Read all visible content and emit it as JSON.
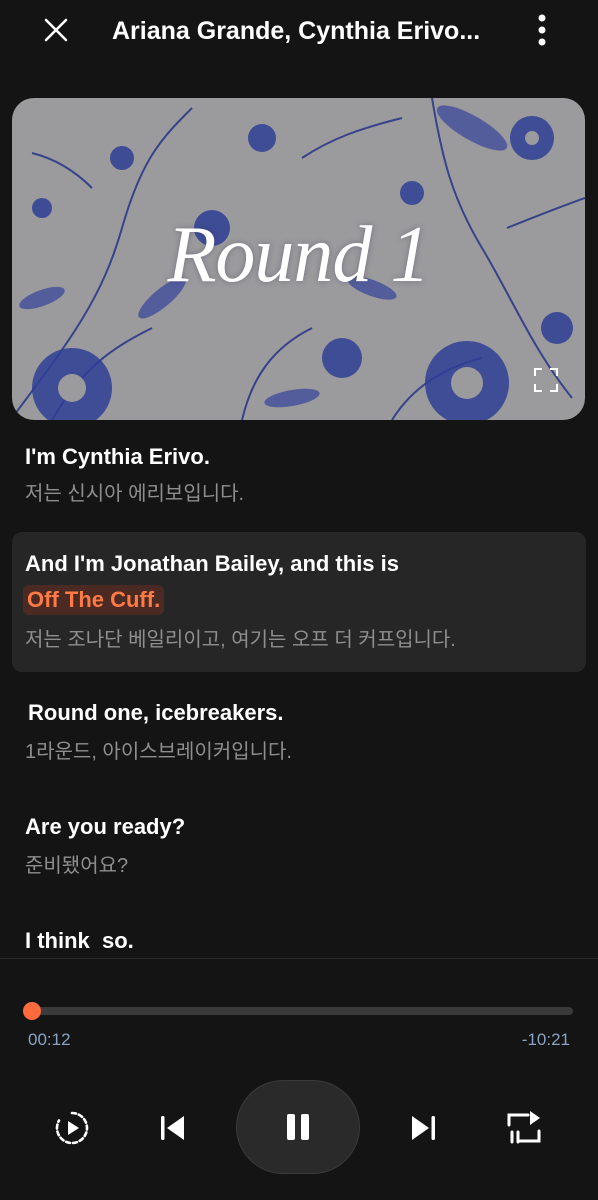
{
  "header": {
    "title": "Ariana Grande, Cynthia Erivo...",
    "close_icon": "close-icon",
    "more_icon": "more-vertical-icon"
  },
  "video": {
    "title": "Round 1",
    "fullscreen_icon": "fullscreen-icon"
  },
  "transcript": [
    {
      "en": "I'm Cynthia Erivo.",
      "ko": "저는 신시아 에리보입니다.",
      "active": false
    },
    {
      "en": "And I'm Jonathan Bailey, and this is",
      "en_highlight": "Off The Cuff.",
      "ko": "저는 조나단 베일리이고, 여기는 오프 더 커프입니다.",
      "active": true
    },
    {
      "en": "Round one, icebreakers.",
      "ko": "1라운드, 아이스브레이커입니다.",
      "active": false
    },
    {
      "en": "Are you ready?",
      "ko": "준비됐어요?",
      "active": false
    },
    {
      "en": "I think  so.",
      "ko": "",
      "active": false
    }
  ],
  "player": {
    "elapsed": "00:12",
    "remaining": "-10:21",
    "progress": 0.0
  },
  "controls": {
    "speed_icon": "playback-speed-icon",
    "previous_icon": "skip-previous-icon",
    "pause_icon": "pause-icon",
    "next_icon": "skip-next-icon",
    "subtitle_icon": "subtitle-mode-icon"
  },
  "colors": {
    "accent": "#ff6b3d",
    "background": "#141414",
    "time_text": "#8aa2c2"
  }
}
